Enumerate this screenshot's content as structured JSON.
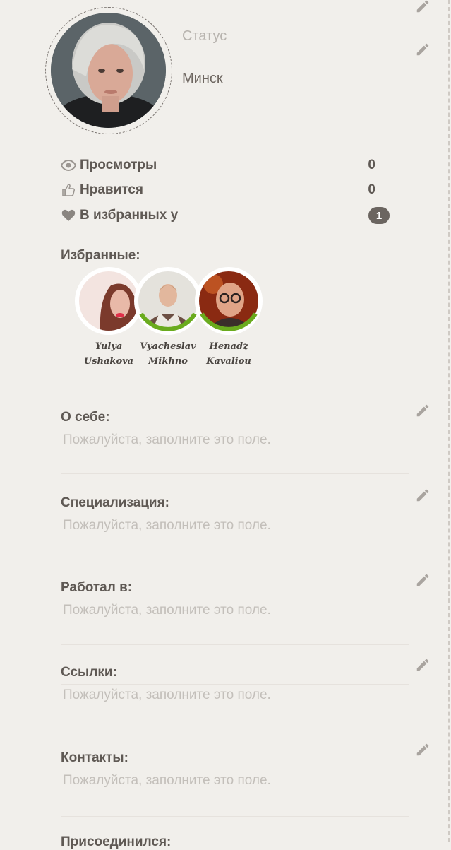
{
  "profile": {
    "status": "Статус",
    "city": "Минск"
  },
  "stats": {
    "views_label": "Просмотры",
    "views_value": "0",
    "likes_label": "Нравится",
    "likes_value": "0",
    "favorited_label": "В избранных у",
    "favorited_value": "1"
  },
  "favorites": {
    "title": "Избранные:",
    "people": [
      {
        "first": "Yulya",
        "last": "Ushakova",
        "online": false
      },
      {
        "first": "Vyacheslav",
        "last": "Mikhno",
        "online": true
      },
      {
        "first": "Henadz",
        "last": "Kavaliou",
        "online": true
      }
    ]
  },
  "sections": [
    {
      "title": "О себе:",
      "placeholder": "Пожалуйста, заполните это поле."
    },
    {
      "title": "Специализация:",
      "placeholder": "Пожалуйста, заполните это поле."
    },
    {
      "title": "Работал в:",
      "placeholder": "Пожалуйста, заполните это поле."
    },
    {
      "title": "Ссылки:",
      "placeholder": "Пожалуйста, заполните это поле."
    },
    {
      "title": "Контакты:",
      "placeholder": "Пожалуйста, заполните это поле."
    },
    {
      "title": "Присоединился:"
    }
  ],
  "colors": {
    "background": "#f1efeb",
    "online": "#6aab1e",
    "text": "#5f5954",
    "placeholder": "#c3bfba"
  }
}
